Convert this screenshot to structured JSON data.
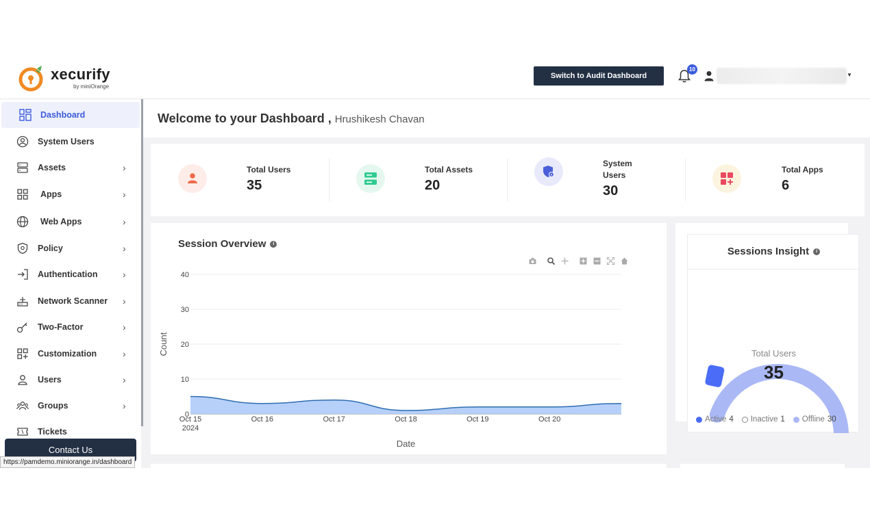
{
  "header": {
    "logo_name": "xecurify",
    "logo_by": "by miniOrange",
    "audit_button": "Switch to Audit Dashboard",
    "notification_count": "10"
  },
  "sidebar": {
    "items": [
      {
        "label": "Dashboard",
        "icon": "dashboard-grid-icon",
        "has_chevron": false,
        "active": true
      },
      {
        "label": "System Users",
        "icon": "user-circle-icon",
        "has_chevron": false
      },
      {
        "label": "Assets",
        "icon": "server-icon",
        "has_chevron": true
      },
      {
        "label": "Apps",
        "icon": "apps-grid-icon",
        "has_chevron": true
      },
      {
        "label": "Web Apps",
        "icon": "globe-icon",
        "has_chevron": true
      },
      {
        "label": "Policy",
        "icon": "shield-icon",
        "has_chevron": true
      },
      {
        "label": "Authentication",
        "icon": "login-arrow-icon",
        "has_chevron": true
      },
      {
        "label": "Network Scanner",
        "icon": "router-icon",
        "has_chevron": true
      },
      {
        "label": "Two-Factor",
        "icon": "key-icon",
        "has_chevron": true
      },
      {
        "label": "Customization",
        "icon": "grid-plus-icon",
        "has_chevron": true
      },
      {
        "label": "Users",
        "icon": "user-icon",
        "has_chevron": true
      },
      {
        "label": "Groups",
        "icon": "group-icon",
        "has_chevron": true
      },
      {
        "label": "Tickets",
        "icon": "ticket-icon",
        "has_chevron": false
      }
    ],
    "contact_button": "Contact Us",
    "status_url": "https://pamdemo.miniorange.in/dashboard"
  },
  "welcome": {
    "title": "Welcome to your Dashboard ,",
    "name": "Hrushikesh Chavan"
  },
  "stats": [
    {
      "label": "Total Users",
      "value": "35",
      "icon": "user-icon",
      "color": "#f06a4a",
      "bg": "#fdece8"
    },
    {
      "label": "Total Assets",
      "value": "20",
      "icon": "server-icon",
      "color": "#2ecc8f",
      "bg": "#e5f8f0"
    },
    {
      "label_line1": "System",
      "label_line2": "Users",
      "value": "30",
      "icon": "shield-user-icon",
      "color": "#4a5fd8",
      "bg": "#e8eafb"
    },
    {
      "label": "Total Apps",
      "value": "6",
      "icon": "apps-plus-icon",
      "color": "#e84a5f",
      "bg": "#fdf4e0"
    }
  ],
  "session_overview": {
    "title": "Session Overview",
    "info": "i"
  },
  "chart_data": {
    "type": "area",
    "x": [
      "2024-10-15",
      "2024-10-16",
      "2024-10-17",
      "2024-10-18",
      "2024-10-19",
      "2024-10-20",
      "2024-10-21"
    ],
    "values": [
      5,
      3,
      4,
      1,
      2,
      2,
      3
    ],
    "xtick_labels": [
      "Oct 15\n2024",
      "Oct 16",
      "Oct 17",
      "Oct 18",
      "Oct 19",
      "Oct 20"
    ],
    "yticks": [
      0,
      10,
      20,
      30,
      40
    ],
    "xlabel": "Date",
    "ylabel": "Count",
    "ylim": [
      0,
      40
    ],
    "fill_color": "#aecbfa",
    "line_color": "#2f6db0",
    "grid": true
  },
  "sessions_insight": {
    "title": "Sessions Insight",
    "info": "i",
    "gauge_label": "Total Users",
    "gauge_value": "35",
    "legend": [
      {
        "label": "Active",
        "value": "4",
        "color": "#4a6cf7"
      },
      {
        "label": "Inactive",
        "value": "1",
        "color": "#ffffff"
      },
      {
        "label": "Offline",
        "value": "30",
        "color": "#aab8f5"
      }
    ],
    "gauge": {
      "active": 4,
      "inactive": 1,
      "offline": 30,
      "total": 35
    }
  }
}
